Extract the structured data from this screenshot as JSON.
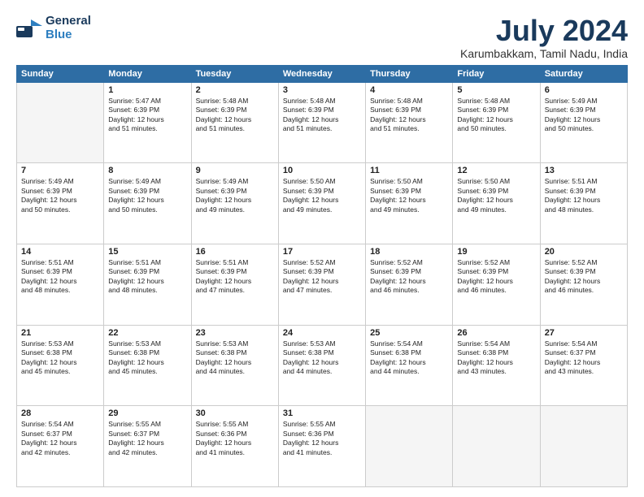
{
  "logo": {
    "line1": "General",
    "line2": "Blue"
  },
  "title": "July 2024",
  "subtitle": "Karumbakkam, Tamil Nadu, India",
  "days_of_week": [
    "Sunday",
    "Monday",
    "Tuesday",
    "Wednesday",
    "Thursday",
    "Friday",
    "Saturday"
  ],
  "weeks": [
    [
      {
        "day": "",
        "sunrise": "",
        "sunset": "",
        "daylight": "",
        "empty": true
      },
      {
        "day": "1",
        "sunrise": "Sunrise: 5:47 AM",
        "sunset": "Sunset: 6:39 PM",
        "daylight": "Daylight: 12 hours and 51 minutes."
      },
      {
        "day": "2",
        "sunrise": "Sunrise: 5:48 AM",
        "sunset": "Sunset: 6:39 PM",
        "daylight": "Daylight: 12 hours and 51 minutes."
      },
      {
        "day": "3",
        "sunrise": "Sunrise: 5:48 AM",
        "sunset": "Sunset: 6:39 PM",
        "daylight": "Daylight: 12 hours and 51 minutes."
      },
      {
        "day": "4",
        "sunrise": "Sunrise: 5:48 AM",
        "sunset": "Sunset: 6:39 PM",
        "daylight": "Daylight: 12 hours and 51 minutes."
      },
      {
        "day": "5",
        "sunrise": "Sunrise: 5:48 AM",
        "sunset": "Sunset: 6:39 PM",
        "daylight": "Daylight: 12 hours and 50 minutes."
      },
      {
        "day": "6",
        "sunrise": "Sunrise: 5:49 AM",
        "sunset": "Sunset: 6:39 PM",
        "daylight": "Daylight: 12 hours and 50 minutes."
      }
    ],
    [
      {
        "day": "7",
        "sunrise": "Sunrise: 5:49 AM",
        "sunset": "Sunset: 6:39 PM",
        "daylight": "Daylight: 12 hours and 50 minutes."
      },
      {
        "day": "8",
        "sunrise": "Sunrise: 5:49 AM",
        "sunset": "Sunset: 6:39 PM",
        "daylight": "Daylight: 12 hours and 50 minutes."
      },
      {
        "day": "9",
        "sunrise": "Sunrise: 5:49 AM",
        "sunset": "Sunset: 6:39 PM",
        "daylight": "Daylight: 12 hours and 49 minutes."
      },
      {
        "day": "10",
        "sunrise": "Sunrise: 5:50 AM",
        "sunset": "Sunset: 6:39 PM",
        "daylight": "Daylight: 12 hours and 49 minutes."
      },
      {
        "day": "11",
        "sunrise": "Sunrise: 5:50 AM",
        "sunset": "Sunset: 6:39 PM",
        "daylight": "Daylight: 12 hours and 49 minutes."
      },
      {
        "day": "12",
        "sunrise": "Sunrise: 5:50 AM",
        "sunset": "Sunset: 6:39 PM",
        "daylight": "Daylight: 12 hours and 49 minutes."
      },
      {
        "day": "13",
        "sunrise": "Sunrise: 5:51 AM",
        "sunset": "Sunset: 6:39 PM",
        "daylight": "Daylight: 12 hours and 48 minutes."
      }
    ],
    [
      {
        "day": "14",
        "sunrise": "Sunrise: 5:51 AM",
        "sunset": "Sunset: 6:39 PM",
        "daylight": "Daylight: 12 hours and 48 minutes."
      },
      {
        "day": "15",
        "sunrise": "Sunrise: 5:51 AM",
        "sunset": "Sunset: 6:39 PM",
        "daylight": "Daylight: 12 hours and 48 minutes."
      },
      {
        "day": "16",
        "sunrise": "Sunrise: 5:51 AM",
        "sunset": "Sunset: 6:39 PM",
        "daylight": "Daylight: 12 hours and 47 minutes."
      },
      {
        "day": "17",
        "sunrise": "Sunrise: 5:52 AM",
        "sunset": "Sunset: 6:39 PM",
        "daylight": "Daylight: 12 hours and 47 minutes."
      },
      {
        "day": "18",
        "sunrise": "Sunrise: 5:52 AM",
        "sunset": "Sunset: 6:39 PM",
        "daylight": "Daylight: 12 hours and 46 minutes."
      },
      {
        "day": "19",
        "sunrise": "Sunrise: 5:52 AM",
        "sunset": "Sunset: 6:39 PM",
        "daylight": "Daylight: 12 hours and 46 minutes."
      },
      {
        "day": "20",
        "sunrise": "Sunrise: 5:52 AM",
        "sunset": "Sunset: 6:39 PM",
        "daylight": "Daylight: 12 hours and 46 minutes."
      }
    ],
    [
      {
        "day": "21",
        "sunrise": "Sunrise: 5:53 AM",
        "sunset": "Sunset: 6:38 PM",
        "daylight": "Daylight: 12 hours and 45 minutes."
      },
      {
        "day": "22",
        "sunrise": "Sunrise: 5:53 AM",
        "sunset": "Sunset: 6:38 PM",
        "daylight": "Daylight: 12 hours and 45 minutes."
      },
      {
        "day": "23",
        "sunrise": "Sunrise: 5:53 AM",
        "sunset": "Sunset: 6:38 PM",
        "daylight": "Daylight: 12 hours and 44 minutes."
      },
      {
        "day": "24",
        "sunrise": "Sunrise: 5:53 AM",
        "sunset": "Sunset: 6:38 PM",
        "daylight": "Daylight: 12 hours and 44 minutes."
      },
      {
        "day": "25",
        "sunrise": "Sunrise: 5:54 AM",
        "sunset": "Sunset: 6:38 PM",
        "daylight": "Daylight: 12 hours and 44 minutes."
      },
      {
        "day": "26",
        "sunrise": "Sunrise: 5:54 AM",
        "sunset": "Sunset: 6:38 PM",
        "daylight": "Daylight: 12 hours and 43 minutes."
      },
      {
        "day": "27",
        "sunrise": "Sunrise: 5:54 AM",
        "sunset": "Sunset: 6:37 PM",
        "daylight": "Daylight: 12 hours and 43 minutes."
      }
    ],
    [
      {
        "day": "28",
        "sunrise": "Sunrise: 5:54 AM",
        "sunset": "Sunset: 6:37 PM",
        "daylight": "Daylight: 12 hours and 42 minutes."
      },
      {
        "day": "29",
        "sunrise": "Sunrise: 5:55 AM",
        "sunset": "Sunset: 6:37 PM",
        "daylight": "Daylight: 12 hours and 42 minutes."
      },
      {
        "day": "30",
        "sunrise": "Sunrise: 5:55 AM",
        "sunset": "Sunset: 6:36 PM",
        "daylight": "Daylight: 12 hours and 41 minutes."
      },
      {
        "day": "31",
        "sunrise": "Sunrise: 5:55 AM",
        "sunset": "Sunset: 6:36 PM",
        "daylight": "Daylight: 12 hours and 41 minutes."
      },
      {
        "day": "",
        "sunrise": "",
        "sunset": "",
        "daylight": "",
        "empty": true
      },
      {
        "day": "",
        "sunrise": "",
        "sunset": "",
        "daylight": "",
        "empty": true
      },
      {
        "day": "",
        "sunrise": "",
        "sunset": "",
        "daylight": "",
        "empty": true
      }
    ]
  ]
}
